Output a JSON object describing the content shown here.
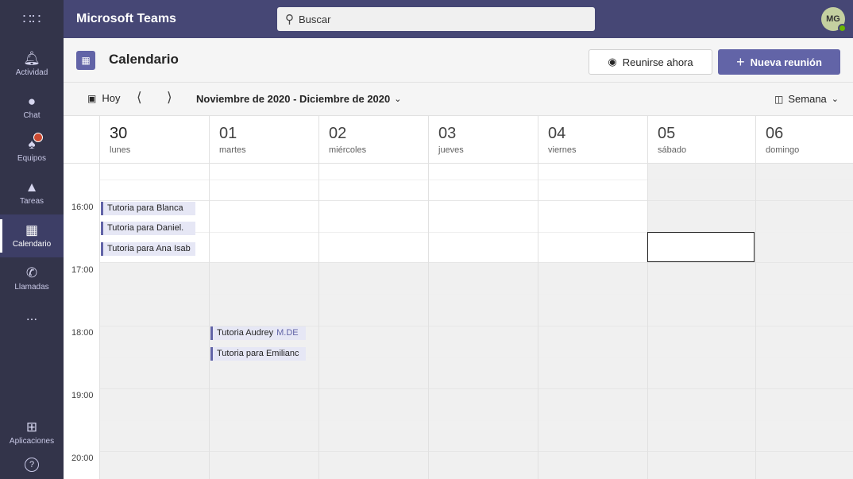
{
  "topbar": {
    "app_title": "Microsoft Teams",
    "search_placeholder": "Buscar",
    "avatar_initials": "MG"
  },
  "rail": {
    "items": [
      {
        "label": "Actividad",
        "icon": "bell-icon"
      },
      {
        "label": "Chat",
        "icon": "chat-icon"
      },
      {
        "label": "Equipos",
        "icon": "teams-icon"
      },
      {
        "label": "Tareas",
        "icon": "tasks-icon"
      },
      {
        "label": "Calendario",
        "icon": "calendar-icon"
      },
      {
        "label": "Llamadas",
        "icon": "phone-icon"
      },
      {
        "label": "Aplicaciones",
        "icon": "apps-icon"
      }
    ],
    "more": "...",
    "help": "?"
  },
  "header": {
    "title": "Calendario",
    "meet_now": "Reunirse ahora",
    "new_meeting": "Nueva reunión"
  },
  "nav": {
    "today": "Hoy",
    "range": "Noviembre de 2020 - Diciembre de 2020",
    "view": "Semana"
  },
  "days": [
    {
      "num": "30",
      "name": "lunes"
    },
    {
      "num": "01",
      "name": "martes"
    },
    {
      "num": "02",
      "name": "miércoles"
    },
    {
      "num": "03",
      "name": "jueves"
    },
    {
      "num": "04",
      "name": "viernes"
    },
    {
      "num": "05",
      "name": "sábado"
    },
    {
      "num": "06",
      "name": "domingo"
    }
  ],
  "times": [
    "16:00",
    "17:00",
    "18:00",
    "19:00",
    "20:00"
  ],
  "events": [
    {
      "title": "Tutoria para Blanca",
      "org": ""
    },
    {
      "title": "Tutoria para Daniel.",
      "org": ""
    },
    {
      "title": "Tutoria para Ana Isab",
      "org": ""
    },
    {
      "title": "Tutoria Audrey",
      "org": "M.DE"
    },
    {
      "title": "Tutoria para Emilianc",
      "org": ""
    }
  ],
  "colors": {
    "accent": "#6264a7",
    "topbar": "#464775",
    "rail": "#33344a",
    "presence": "#6bb700"
  }
}
